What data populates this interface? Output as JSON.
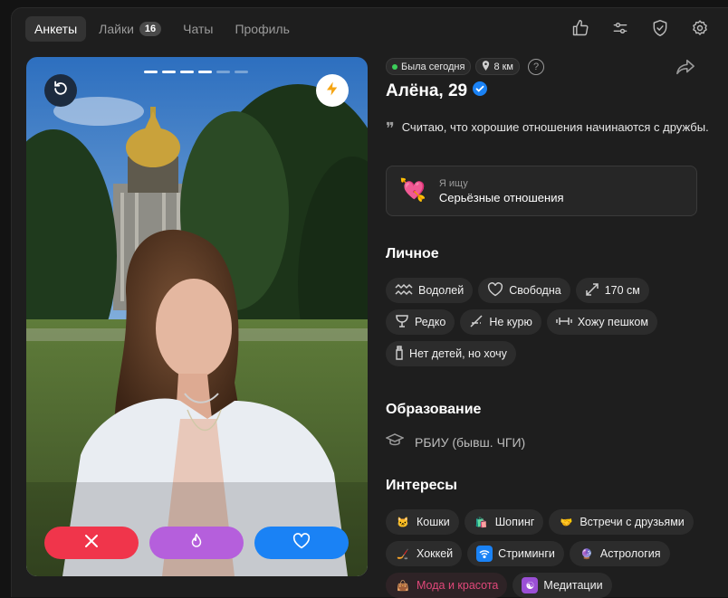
{
  "nav": {
    "tabs": [
      {
        "label": "Анкеты"
      },
      {
        "label": "Лайки",
        "badge": "16"
      },
      {
        "label": "Чаты"
      },
      {
        "label": "Профиль"
      }
    ],
    "icons": [
      "thumbs-up-icon",
      "sliders-icon",
      "shield-check-icon",
      "gear-icon"
    ]
  },
  "photo": {
    "progress_total": 6,
    "progress_done": 4,
    "buttons": {
      "undo": "undo-icon",
      "boost": "lightning-icon",
      "dislike": "close-icon",
      "superlike": "flame-icon",
      "like": "heart-icon"
    },
    "colors": {
      "dislike": "#f0354b",
      "superlike": "#b55fdc",
      "like": "#1a82f5"
    }
  },
  "profile": {
    "status": "Была сегодня",
    "distance": "8 км",
    "help": "?",
    "name": "Алёна, 29",
    "bio": "Считаю, что хорошие отношения начинаются с дружбы.",
    "looking_for": {
      "label": "Я ищу",
      "value": "Серьёзные отношения"
    }
  },
  "personal": {
    "title": "Личное",
    "tags": [
      {
        "label": "Водолей",
        "icon": "aquarius-icon"
      },
      {
        "label": "Свободна",
        "icon": "heart-outline-icon"
      },
      {
        "label": "170 см",
        "icon": "height-icon"
      },
      {
        "label": "Редко",
        "icon": "glass-icon"
      },
      {
        "label": "Не курю",
        "icon": "no-smoking-icon"
      },
      {
        "label": "Хожу пешком",
        "icon": "dumbbell-icon"
      },
      {
        "label": "Нет детей, но хочу",
        "icon": "bottle-icon"
      }
    ]
  },
  "education": {
    "title": "Образование",
    "value": "РБИУ (бывш. ЧГИ)"
  },
  "interests": {
    "title": "Интересы",
    "tags": [
      {
        "label": "Кошки",
        "icon": "cat-icon"
      },
      {
        "label": "Шопинг",
        "icon": "shopping-bag-icon"
      },
      {
        "label": "Встречи с друзьями",
        "icon": "handshake-icon"
      },
      {
        "label": "Хоккей",
        "icon": "hockey-icon"
      },
      {
        "label": "Стриминги",
        "icon": "wifi-icon"
      },
      {
        "label": "Астрология",
        "icon": "crystal-ball-icon"
      },
      {
        "label": "Мода и красота",
        "icon": "handbag-icon"
      },
      {
        "label": "Медитации",
        "icon": "yin-yang-icon"
      }
    ]
  }
}
